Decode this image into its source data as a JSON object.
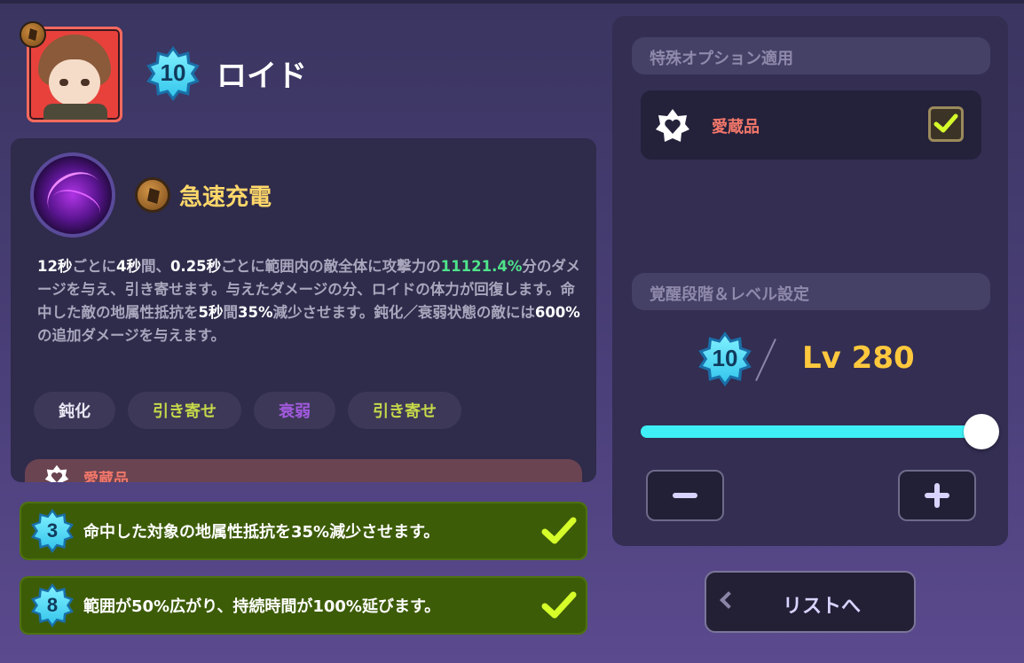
{
  "hero": {
    "name": "ロイド",
    "awakening": "10"
  },
  "skill": {
    "name": "急速充電",
    "description": [
      {
        "t": "12秒",
        "c": "w"
      },
      {
        "t": "ごとに",
        "c": ""
      },
      {
        "t": "4秒",
        "c": "w"
      },
      {
        "t": "間、",
        "c": ""
      },
      {
        "t": "0.25秒",
        "c": "w"
      },
      {
        "t": "ごとに範囲内の敵全体に攻撃力の",
        "c": ""
      },
      {
        "t": "11121.4%",
        "c": "g"
      },
      {
        "t": "分のダメージを与え、引き寄せます。与えたダメージの分、ロイドの体力が回復します。命中した敵の地属性抵抗を",
        "c": ""
      },
      {
        "t": "5秒",
        "c": "w"
      },
      {
        "t": "間",
        "c": ""
      },
      {
        "t": "35%",
        "c": "w"
      },
      {
        "t": "減少させます。鈍化／衰弱状態の敵には",
        "c": ""
      },
      {
        "t": "600%",
        "c": "w"
      },
      {
        "t": "の追加ダメージを与えます。",
        "c": ""
      }
    ],
    "tags": [
      {
        "label": "鈍化",
        "color": "#e9e6f3"
      },
      {
        "label": "引き寄せ",
        "color": "#c6d84a"
      },
      {
        "label": "衰弱",
        "color": "#a35ae0"
      },
      {
        "label": "引き寄せ",
        "color": "#c6d84a"
      }
    ],
    "favorite_label": "愛蔵品"
  },
  "options": [
    {
      "level": "3",
      "text": "命中した対象の地属性抵抗を35%減少させます。"
    },
    {
      "level": "8",
      "text": "範囲が50%広がり、持続時間が100%延びます。"
    }
  ],
  "right_panel": {
    "special_header": "特殊オプション適用",
    "favorite_label": "愛蔵品",
    "favorite_checked": true,
    "level_header": "覚醒段階＆レベル設定",
    "awakening": "10",
    "level_text": "Lv 280",
    "slider_fraction": 1.0
  },
  "list_button": "リストへ",
  "colors": {
    "accent_cyan": "#3ef0f6",
    "level_gold": "#ffc83d",
    "favorite_red": "#f3776a",
    "option_green": "#3d5c08",
    "check_yellow": "#d6ff2a"
  }
}
